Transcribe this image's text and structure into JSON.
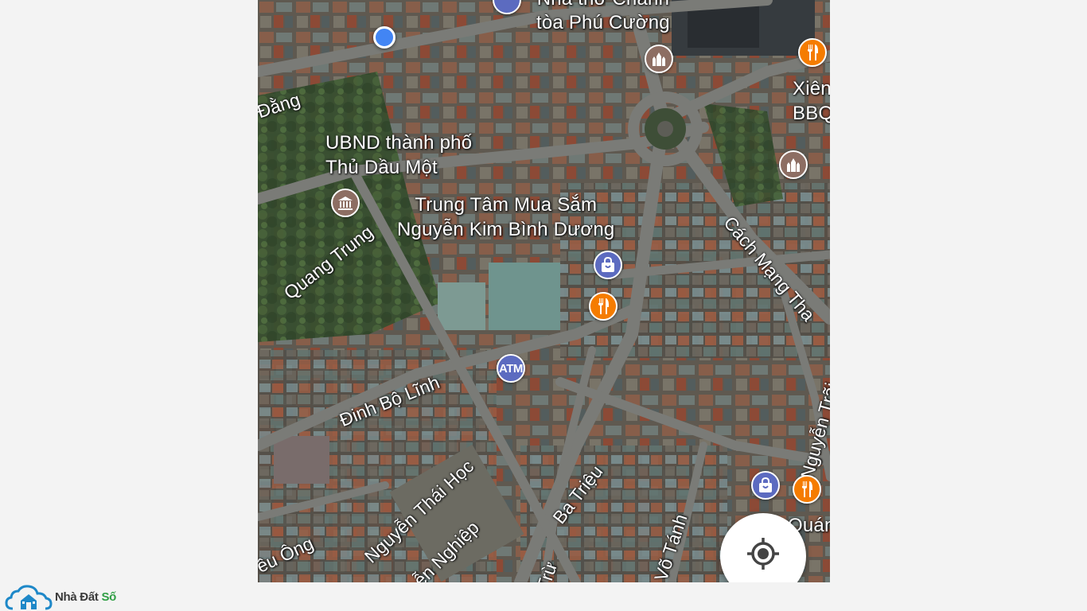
{
  "map": {
    "place_labels": [
      {
        "id": "church",
        "lines": [
          "Nhà thờ Chánh",
          "tòa Phú Cường"
        ]
      },
      {
        "id": "ubnd",
        "lines": [
          "UBND thành phố",
          "Thủ Dầu Một"
        ]
      },
      {
        "id": "mall",
        "lines": [
          "Trung Tâm Mua Sắm",
          "Nguyễn Kim Bình Dương"
        ]
      },
      {
        "id": "bbq",
        "lines": [
          "Xiên",
          "BBQ"
        ]
      },
      {
        "id": "quan",
        "lines": [
          "Quán"
        ]
      }
    ],
    "streets": {
      "dang": "Đằng",
      "quang_trung": "Quang Trung",
      "cach_mang": "Cách Mạng Tha",
      "dinh_bo_linh": "Đinh Bộ Lĩnh",
      "nguyen_trai": "Nguyễn Trãi",
      "nguyen_thai_hoc": "Nguyễn Thái Học",
      "ba_trieu": "Ba Triệu",
      "nghiep": "ễn Nghiệp",
      "ong": "ều Ông",
      "vo_tanh": "Võ Tánh",
      "tru": "Trừ"
    },
    "poi_atm_label": "ATM",
    "poi_colors": {
      "worship": "#8d6e63",
      "restaurant": "#f57c00",
      "shopping": "#5c6bc0",
      "atm": "#5c6bc0",
      "civic": "#8d6e63",
      "location": "#4285f4"
    }
  },
  "controls": {
    "locate_icon": "my-location-icon"
  },
  "watermark": {
    "brand_main": "Nhà Đất ",
    "brand_accent": "Số",
    "logo_icon": "cloud-house-icon"
  }
}
